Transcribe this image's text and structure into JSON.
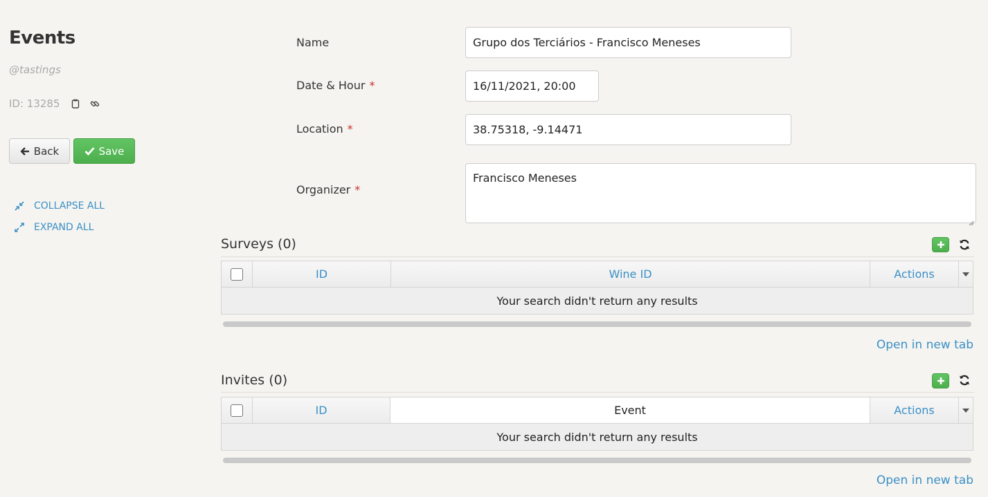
{
  "header": {
    "title": "Events",
    "subtitle": "@tastings",
    "id_text": "ID: 13285"
  },
  "actions": {
    "back_label": "Back",
    "save_label": "Save"
  },
  "sidebar": {
    "collapse_label": "COLLAPSE ALL",
    "expand_label": "EXPAND ALL"
  },
  "form": {
    "name": {
      "label": "Name",
      "value": "Grupo dos Terciários - Francisco Meneses"
    },
    "date": {
      "label": "Date & Hour",
      "required": "*",
      "value": "16/11/2021, 20:00"
    },
    "location": {
      "label": "Location",
      "required": "*",
      "value": "38.75318, -9.14471"
    },
    "organizer": {
      "label": "Organizer",
      "required": "*",
      "value": "Francisco Meneses"
    }
  },
  "surveys": {
    "title": "Surveys (0)",
    "columns": [
      "ID",
      "Wine ID",
      "Actions"
    ],
    "empty_text": "Your search didn't return any results",
    "open_tab_label": "Open in new tab"
  },
  "invites": {
    "title": "Invites (0)",
    "columns": [
      "ID",
      "Event",
      "Actions"
    ],
    "empty_text": "Your search didn't return any results",
    "open_tab_label": "Open in new tab"
  },
  "colors": {
    "accent_link": "#3a8fc6",
    "save_green": "#4cae4c",
    "required_red": "#c9302c"
  },
  "icons": [
    "arrow-left-icon",
    "check-icon",
    "clipboard-icon",
    "link-icon",
    "collapse-icon",
    "expand-icon",
    "plus-icon",
    "refresh-icon",
    "caret-down-icon"
  ]
}
